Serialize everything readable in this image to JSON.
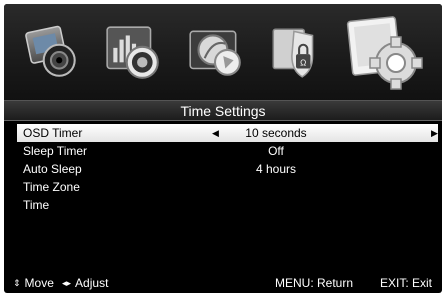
{
  "menu": {
    "tiles": [
      {
        "name": "picture-icon"
      },
      {
        "name": "sound-icon"
      },
      {
        "name": "channel-icon"
      },
      {
        "name": "lock-icon"
      },
      {
        "name": "setup-gear-icon"
      }
    ],
    "active_index": 4
  },
  "header": {
    "title": "Time Settings"
  },
  "settings": [
    {
      "label": "OSD Timer",
      "value": "10 seconds"
    },
    {
      "label": "Sleep Timer",
      "value": "Off"
    },
    {
      "label": "Auto Sleep",
      "value": "4 hours"
    },
    {
      "label": "Time Zone",
      "value": ""
    },
    {
      "label": "Time",
      "value": ""
    }
  ],
  "footer": {
    "move_glyph": "⇕",
    "move_label": "Move",
    "adjust_glyph": "◂▸",
    "adjust_label": "Adjust",
    "return_label": "MENU: Return",
    "exit_label": "EXIT: Exit"
  },
  "colors": {
    "background": "#000000",
    "highlight": "#ffffff",
    "text": "#ffffff"
  }
}
